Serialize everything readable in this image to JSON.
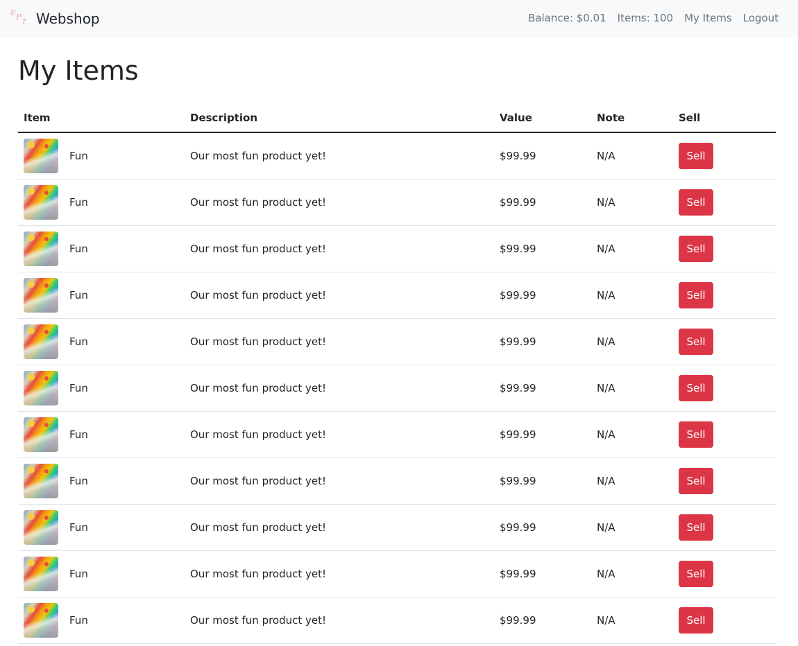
{
  "navbar": {
    "brand": "Webshop",
    "logo_letters": [
      "E",
      "P",
      "T"
    ],
    "balance": "Balance: $0.01",
    "items_count": "Items: 100",
    "my_items": "My Items",
    "logout": "Logout"
  },
  "page": {
    "title": "My Items"
  },
  "table": {
    "headers": {
      "item": "Item",
      "description": "Description",
      "value": "Value",
      "note": "Note",
      "sell": "Sell"
    },
    "rows": [
      {
        "name": "Fun",
        "description": "Our most fun product yet!",
        "value": "$99.99",
        "note": "N/A",
        "sell_label": "Sell"
      },
      {
        "name": "Fun",
        "description": "Our most fun product yet!",
        "value": "$99.99",
        "note": "N/A",
        "sell_label": "Sell"
      },
      {
        "name": "Fun",
        "description": "Our most fun product yet!",
        "value": "$99.99",
        "note": "N/A",
        "sell_label": "Sell"
      },
      {
        "name": "Fun",
        "description": "Our most fun product yet!",
        "value": "$99.99",
        "note": "N/A",
        "sell_label": "Sell"
      },
      {
        "name": "Fun",
        "description": "Our most fun product yet!",
        "value": "$99.99",
        "note": "N/A",
        "sell_label": "Sell"
      },
      {
        "name": "Fun",
        "description": "Our most fun product yet!",
        "value": "$99.99",
        "note": "N/A",
        "sell_label": "Sell"
      },
      {
        "name": "Fun",
        "description": "Our most fun product yet!",
        "value": "$99.99",
        "note": "N/A",
        "sell_label": "Sell"
      },
      {
        "name": "Fun",
        "description": "Our most fun product yet!",
        "value": "$99.99",
        "note": "N/A",
        "sell_label": "Sell"
      },
      {
        "name": "Fun",
        "description": "Our most fun product yet!",
        "value": "$99.99",
        "note": "N/A",
        "sell_label": "Sell"
      },
      {
        "name": "Fun",
        "description": "Our most fun product yet!",
        "value": "$99.99",
        "note": "N/A",
        "sell_label": "Sell"
      },
      {
        "name": "Fun",
        "description": "Our most fun product yet!",
        "value": "$99.99",
        "note": "N/A",
        "sell_label": "Sell"
      }
    ]
  },
  "colors": {
    "navbar_bg": "#f8f9fa",
    "sell_button": "#dc3545",
    "nav_link": "#6c757d"
  }
}
